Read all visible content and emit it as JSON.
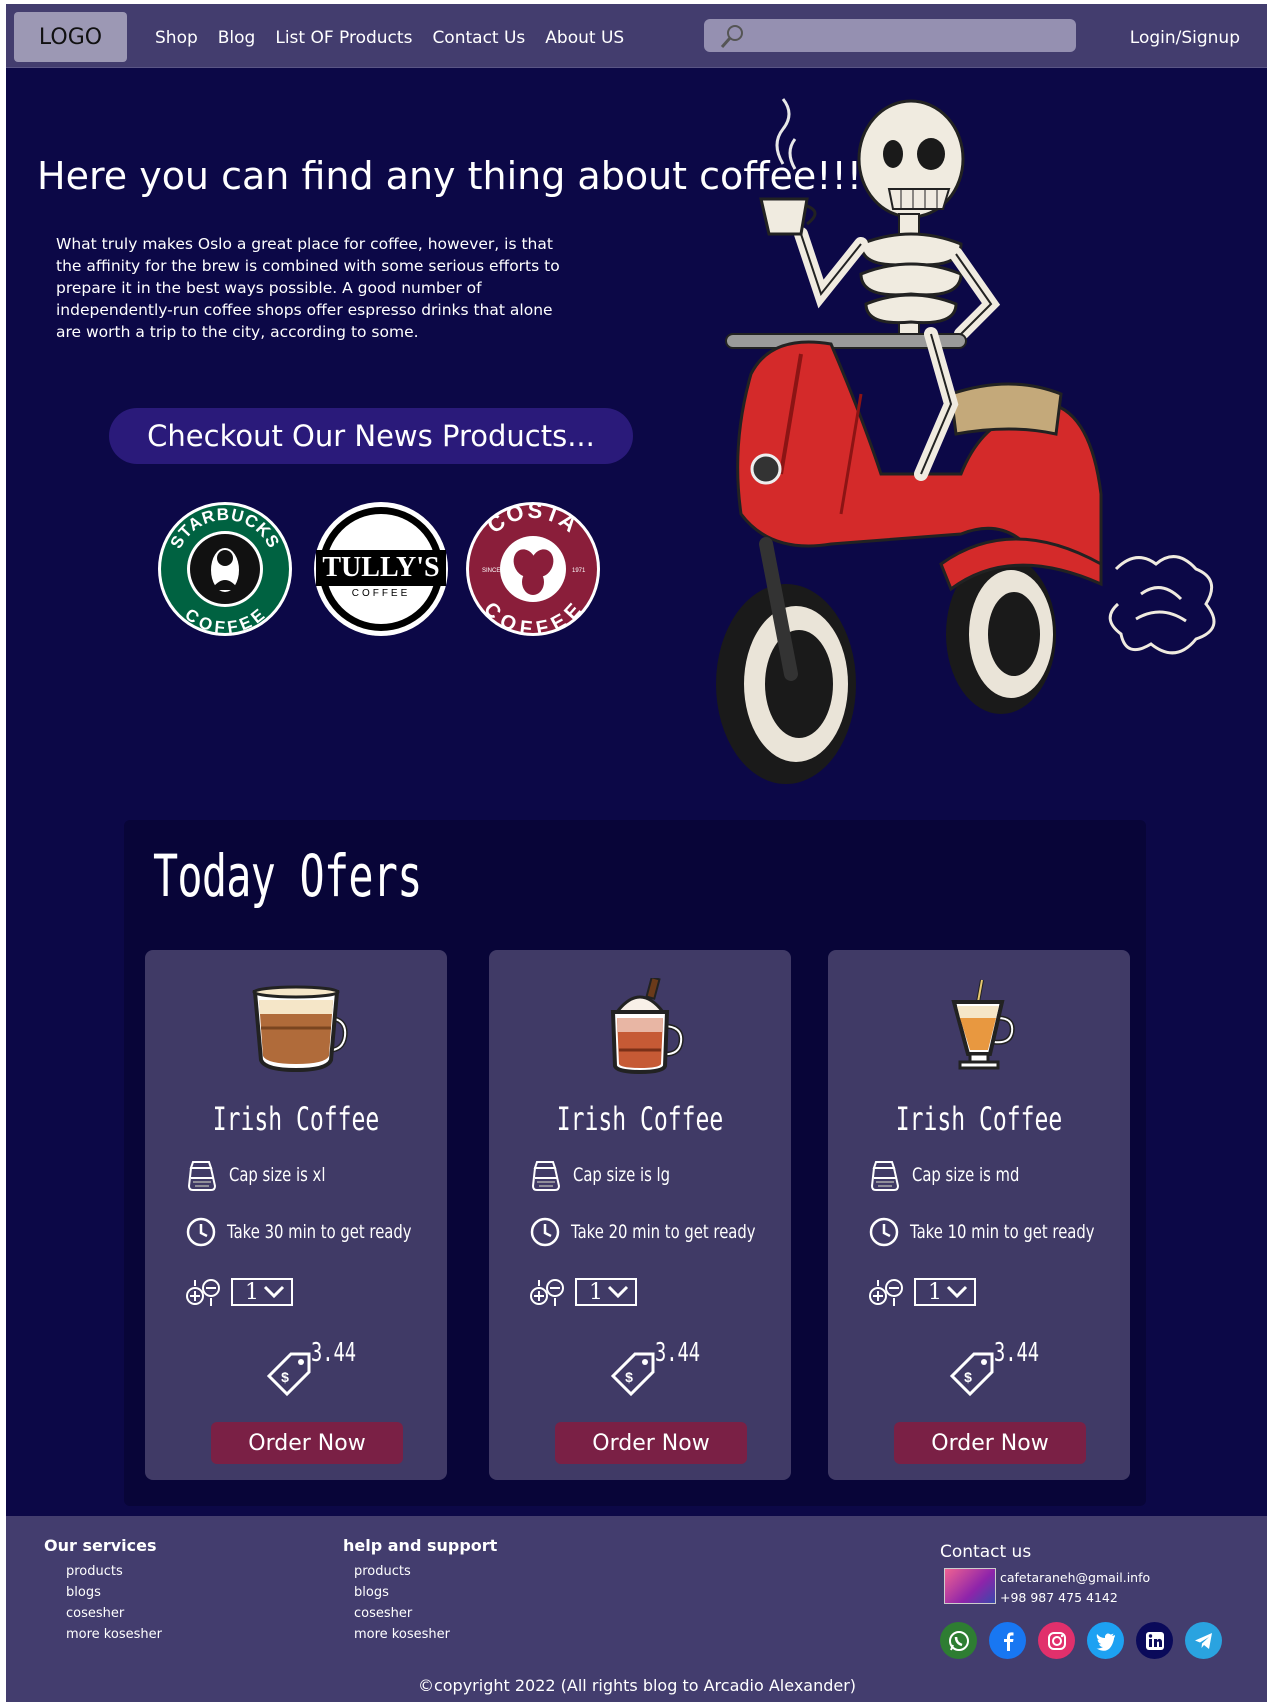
{
  "nav": {
    "logo": "LOGO",
    "links": [
      "Shop",
      "Blog",
      "List OF Products",
      "Contact Us",
      "About US"
    ],
    "login": "Login/Signup"
  },
  "hero": {
    "title": "Here you can find any thing about coffee!!!!",
    "text": "What truly makes Oslo a great place for coffee, however, is that the affinity for the brew is combined with some serious efforts to prepare it in the best ways possible. A good number of independently-run coffee shops offer espresso drinks that alone are worth a trip to the city, according to some.",
    "cta": "Checkout Our News Products...",
    "brands": [
      {
        "name": "starbucks-logo",
        "top": "STARBUCKS",
        "bottom": "COFFEE",
        "color": "#006241"
      },
      {
        "name": "tullys-logo",
        "top": "TULLY'S",
        "bottom": "COFFEE",
        "color": "#000000"
      },
      {
        "name": "costa-logo",
        "top": "COSTA",
        "bottom": "COFFEE",
        "side_left": "SINCE",
        "side_right": "1971",
        "color": "#8a1e3a"
      }
    ]
  },
  "offers": {
    "title": "Today Ofers",
    "cards": [
      {
        "name": "Irish Coffee",
        "size": "Cap size is xl",
        "time": "Take 30 min to get ready",
        "qty": "1",
        "price": "3.44",
        "order": "Order Now"
      },
      {
        "name": "Irish Coffee",
        "size": "Cap size is lg",
        "time": "Take 20 min to get ready",
        "qty": "1",
        "price": "3.44",
        "order": "Order Now"
      },
      {
        "name": "Irish Coffee",
        "size": "Cap size is md",
        "time": "Take 10 min to get ready",
        "qty": "1",
        "price": "3.44",
        "order": "Order Now"
      }
    ]
  },
  "footer": {
    "services": {
      "title": "Our services",
      "items": [
        "products",
        "blogs",
        "cosesher",
        "more kosesher"
      ]
    },
    "support": {
      "title": "help and support",
      "items": [
        "products",
        "blogs",
        "cosesher",
        "more kosesher"
      ]
    },
    "contact": {
      "title": "Contact us",
      "email": "cafetaraneh@gmail.info",
      "phone": "+98 987 475 4142"
    },
    "socials": [
      {
        "name": "whatsapp-icon",
        "color": "#2e7d32"
      },
      {
        "name": "facebook-icon",
        "color": "#1877f2"
      },
      {
        "name": "instagram-icon",
        "color": "#e1306c"
      },
      {
        "name": "twitter-icon",
        "color": "#1da1f2"
      },
      {
        "name": "linkedin-icon",
        "color": "#0a0a5a"
      },
      {
        "name": "telegram-icon",
        "color": "#2aa3e0"
      }
    ],
    "copyright": "©copyright 2022 (All rights blog to Arcadio Alexander)"
  }
}
